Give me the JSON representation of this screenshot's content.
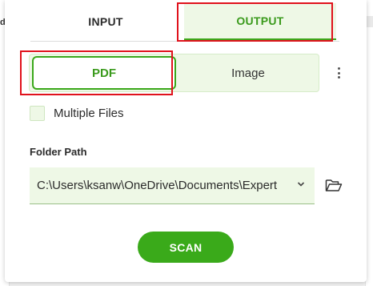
{
  "tabs": {
    "input_label": "INPUT",
    "output_label": "OUTPUT",
    "active": "OUTPUT"
  },
  "format": {
    "options": [
      "PDF",
      "Image"
    ],
    "selected": "PDF"
  },
  "options": {
    "multiple_files_label": "Multiple Files",
    "multiple_files_checked": false
  },
  "folder": {
    "label": "Folder Path",
    "value": "C:\\Users\\ksanw\\OneDrive\\Documents\\Expert"
  },
  "actions": {
    "scan_label": "SCAN"
  },
  "background": {
    "left_peek": "d"
  },
  "icons": {
    "more": "more-vertical-icon",
    "chevron": "chevron-down-icon",
    "folder": "folder-open-icon"
  },
  "colors": {
    "accent": "#3aaa1a",
    "accent_light": "#eef8e6",
    "highlight_box": "#e0121c"
  }
}
